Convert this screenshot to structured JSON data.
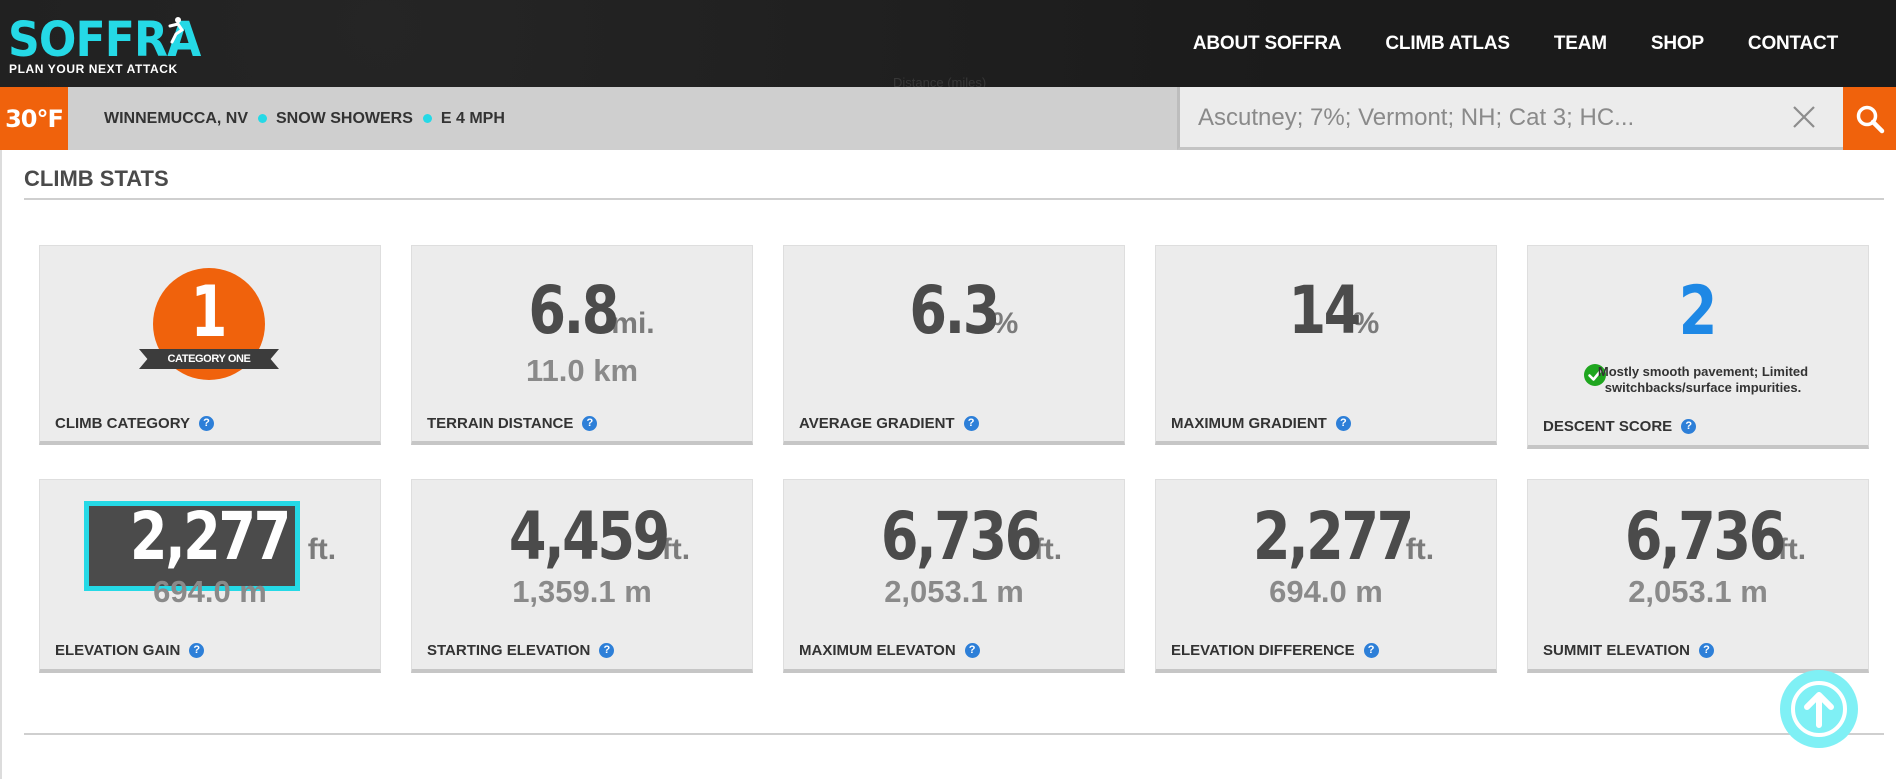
{
  "brand": {
    "logo_text": "SOFFRA",
    "tagline": "PLAN YOUR NEXT ATTACK"
  },
  "nav": [
    "ABOUT SOFFRA",
    "CLIMB ATLAS",
    "TEAM",
    "SHOP",
    "CONTACT"
  ],
  "weather": {
    "temperature": "30°F",
    "location": "WINNEMUCCA, NV",
    "condition": "SNOW SHOWERS",
    "wind": "E 4 MPH"
  },
  "search": {
    "placeholder": "Ascutney; 7%; Vermont; NH; Cat 3; HC..."
  },
  "ghost_label": "Distance (miles)",
  "section": {
    "title": "CLIMB STATS"
  },
  "cards": {
    "category": {
      "value": "1",
      "ribbon": "CATEGORY ONE",
      "label": "CLIMB CATEGORY"
    },
    "terrain_distance": {
      "value": "6.8",
      "unit": "mi.",
      "sub": "11.0 km",
      "label": "TERRAIN DISTANCE"
    },
    "avg_gradient": {
      "value": "6.3",
      "unit": "%",
      "label": "AVERAGE GRADIENT"
    },
    "max_gradient": {
      "value": "14",
      "unit": "%",
      "label": "MAXIMUM GRADIENT"
    },
    "descent": {
      "value": "2",
      "note": "Mostly smooth pavement; Limited switchbacks/surface impurities.",
      "label": "DESCENT SCORE"
    },
    "elevation_gain": {
      "value": "2,277",
      "unit": "ft.",
      "sub": "694.0 m",
      "label": "ELEVATION GAIN"
    },
    "starting_elevation": {
      "value": "4,459",
      "unit": "ft.",
      "sub": "1,359.1 m",
      "label": "STARTING ELEVATION"
    },
    "maximum_elevation": {
      "value": "6,736",
      "unit": "ft.",
      "sub": "2,053.1 m",
      "label": "MAXIMUM ELEVATON"
    },
    "elevation_difference": {
      "value": "2,277",
      "unit": "ft.",
      "sub": "694.0 m",
      "label": "ELEVATION DIFFERENCE"
    },
    "summit_elevation": {
      "value": "6,736",
      "unit": "ft.",
      "sub": "2,053.1 m",
      "label": "SUMMIT ELEVATION"
    }
  },
  "help_glyph": "?",
  "colors": {
    "accent": "#25d9e6",
    "brand_orange": "#f0620c",
    "descent_blue": "#1e88e5",
    "ok_green": "#1fa61f"
  }
}
